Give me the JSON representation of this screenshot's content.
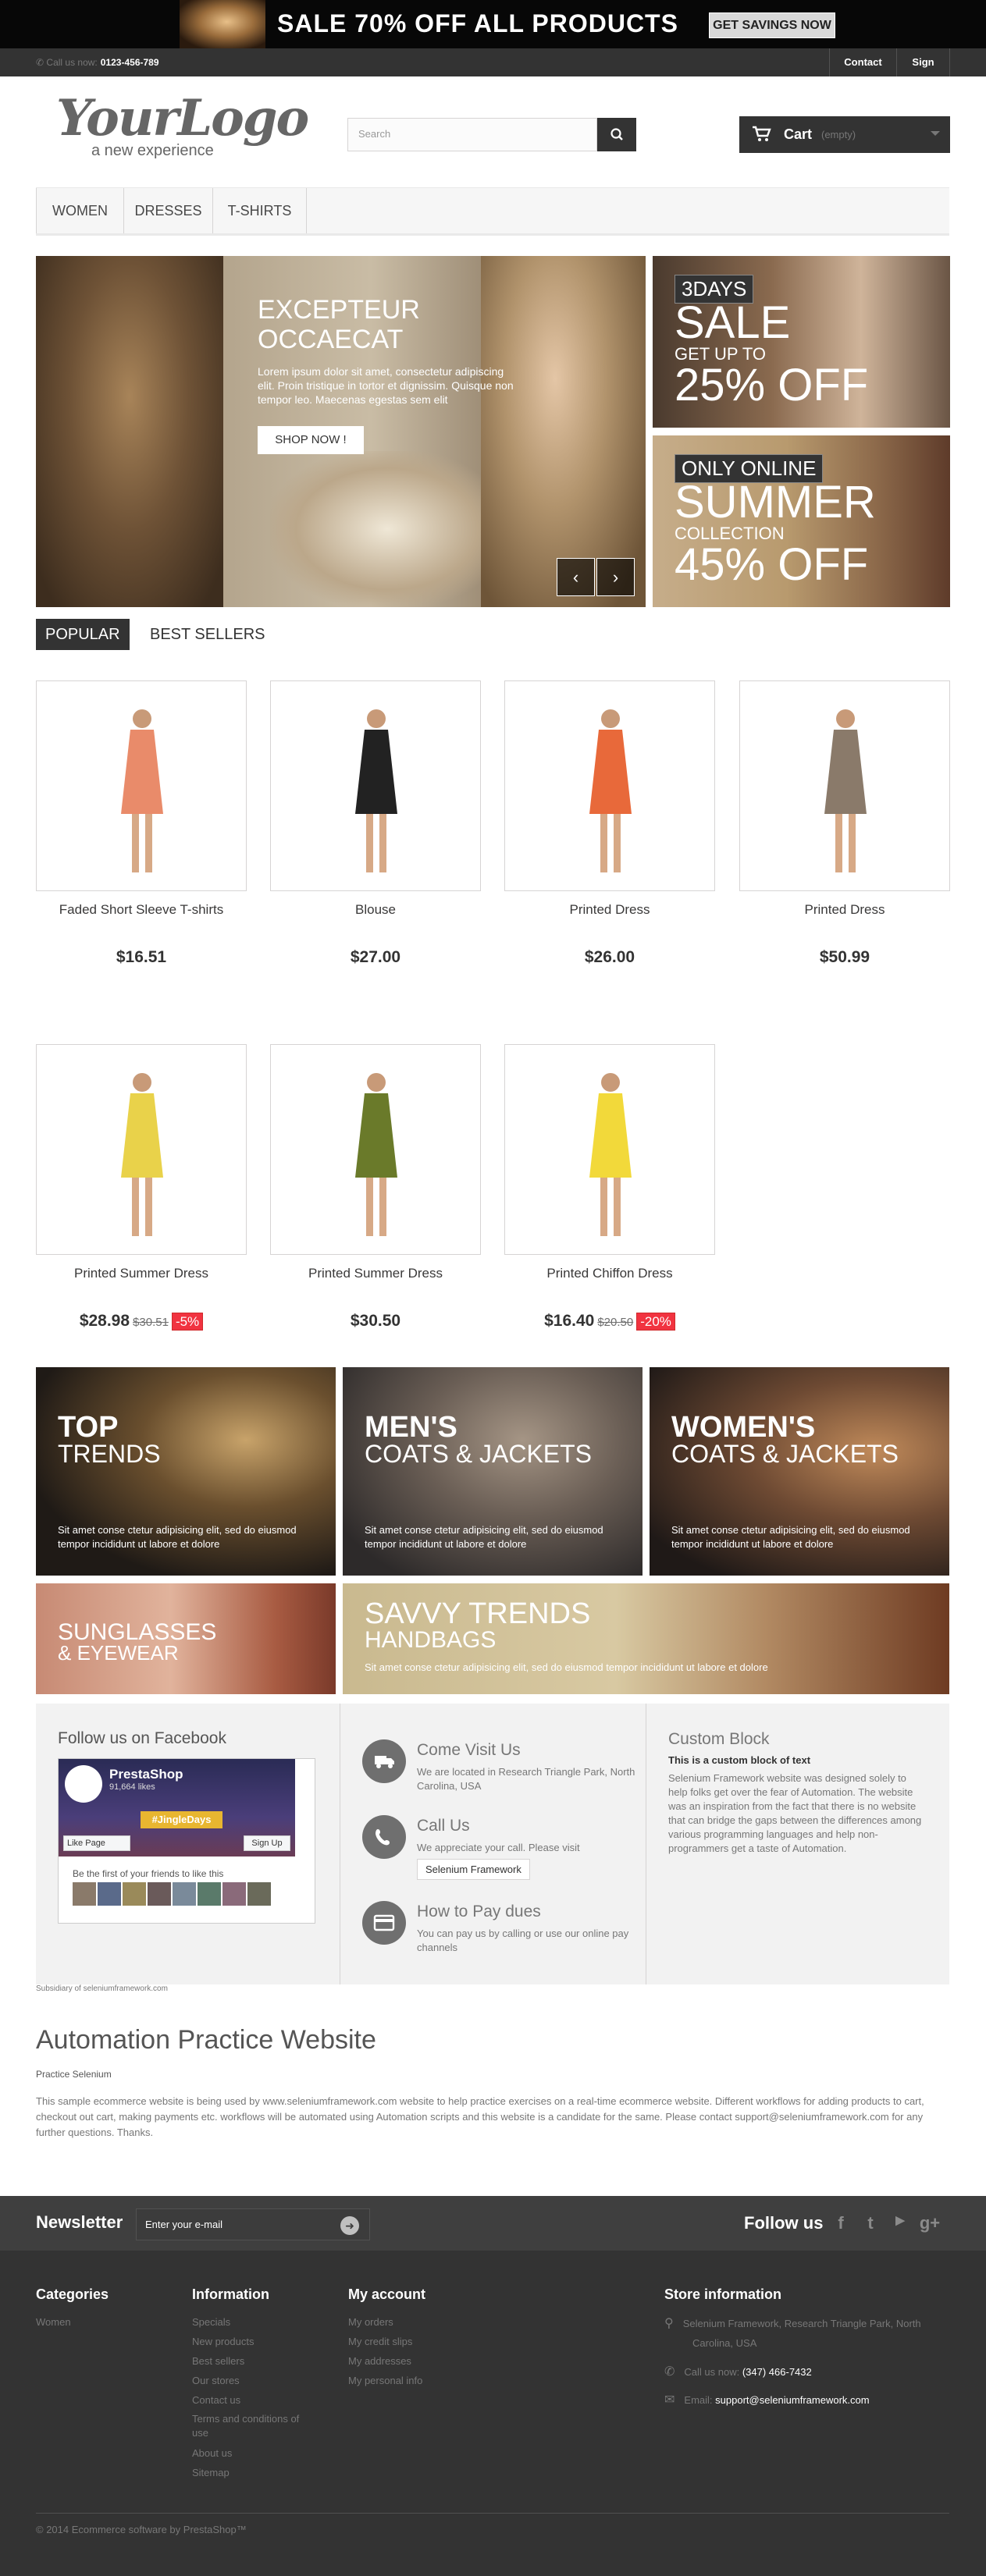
{
  "promo": {
    "text": "SALE 70% OFF ALL PRODUCTS",
    "button": "GET SAVINGS NOW"
  },
  "topbar": {
    "call_label": "Call us now:",
    "phone": "0123-456-789",
    "contact": "Contact us",
    "signin": "Sign in"
  },
  "header": {
    "logo_main": "YourLogo",
    "logo_sub": "a new experience",
    "search_placeholder": "Search",
    "cart_label": "Cart",
    "cart_state": "(empty)"
  },
  "menu": [
    "WOMEN",
    "DRESSES",
    "T-SHIRTS"
  ],
  "slider": {
    "heading_line1": "EXCEPTEUR",
    "heading_line2": "OCCAECAT",
    "text": "Lorem ipsum dolor sit amet, consectetur adipiscing elit. Proin tristique in tortor et dignissim. Quisque non tempor leo. Maecenas egestas sem elit",
    "button": "SHOP NOW !",
    "prev": "‹",
    "next": "›"
  },
  "side_banners": [
    {
      "tag": "3DAYS",
      "big": "SALE",
      "small": "GET UP TO",
      "value": "25% OFF"
    },
    {
      "tag": "ONLY ONLINE",
      "big": "SUMMER",
      "small": "COLLECTION",
      "value": "45% OFF"
    }
  ],
  "tabs": {
    "popular": "POPULAR",
    "best_sellers": "BEST SELLERS"
  },
  "products": [
    {
      "name": "Faded Short Sleeve T-shirts",
      "price": "$16.51",
      "old": "",
      "discount": ""
    },
    {
      "name": "Blouse",
      "price": "$27.00",
      "old": "",
      "discount": ""
    },
    {
      "name": "Printed Dress",
      "price": "$26.00",
      "old": "",
      "discount": ""
    },
    {
      "name": "Printed Dress",
      "price": "$50.99",
      "old": "",
      "discount": ""
    },
    {
      "name": "Printed Summer Dress",
      "price": "$28.98",
      "old": "$30.51",
      "discount": "-5%"
    },
    {
      "name": "Printed Summer Dress",
      "price": "$30.50",
      "old": "",
      "discount": ""
    },
    {
      "name": "Printed Chiffon Dress",
      "price": "$16.40",
      "old": "$20.50",
      "discount": "-20%"
    }
  ],
  "html_banners": [
    {
      "t1": "TOP",
      "t2": "TRENDS",
      "desc": "Sit amet conse ctetur adipisicing elit, sed do eiusmod tempor incididunt ut labore et dolore"
    },
    {
      "t1": "MEN'S",
      "t2": "COATS & JACKETS",
      "desc": "Sit amet conse ctetur adipisicing elit, sed do eiusmod tempor incididunt ut labore et dolore"
    },
    {
      "t1": "WOMEN'S",
      "t2": "COATS & JACKETS",
      "desc": "Sit amet conse ctetur adipisicing elit, sed do eiusmod tempor incididunt ut labore et dolore"
    },
    {
      "t1": "SUNGLASSES",
      "t2": "& EYEWEAR",
      "desc": ""
    },
    {
      "t1": "SAVVY TRENDS",
      "t2": "HANDBAGS",
      "desc": "Sit amet conse ctetur adipisicing elit, sed do eiusmod tempor incididunt ut labore et dolore"
    }
  ],
  "facebook": {
    "title": "Follow us on Facebook",
    "page": "PrestaShop",
    "likes": "91,664 likes",
    "hashtag": "#JingleDays",
    "like_page": "Like Page",
    "sign_up": "Sign Up",
    "first": "Be the first of your friends to like this"
  },
  "cms": [
    {
      "title": "Come Visit Us",
      "text": "We are located in Research Triangle Park, North Carolina, USA",
      "button": ""
    },
    {
      "title": "Call Us",
      "text": "We appreciate your call. Please visit",
      "button": "Selenium Framework"
    },
    {
      "title": "How to Pay dues",
      "text": "You can pay us by calling or use our online pay channels",
      "button": ""
    }
  ],
  "custom_block": {
    "title": "Custom Block",
    "subtitle": "This is a custom block of text",
    "text": "Selenium Framework website was designed solely to help folks get over the fear of Automation. The website was an inspiration from the fact that there is no website that can bridge the gaps between the differences among various programming languages and help non-programmers get a taste of Automation."
  },
  "subsidiary": "Subsidiary of seleniumframework.com",
  "about": {
    "title": "Automation Practice Website",
    "sub": "Practice Selenium",
    "text": "This sample ecommerce website is being used by www.seleniumframework.com website to help practice exercises on a real-time ecommerce website. Different workflows for adding products to cart, checkout out cart, making payments etc. workflows will be automated using Automation scripts and this website is a candidate for the same. Please contact support@seleniumframework.com for any further questions. Thanks."
  },
  "newsletter": {
    "title": "Newsletter",
    "placeholder": "Enter your e-mail",
    "follow": "Follow us"
  },
  "footer": {
    "categories": {
      "title": "Categories",
      "items": [
        "Women"
      ]
    },
    "information": {
      "title": "Information",
      "items": [
        "Specials",
        "New products",
        "Best sellers",
        "Our stores",
        "Contact us",
        "Terms and conditions of",
        "use",
        "About us",
        "Sitemap"
      ]
    },
    "account": {
      "title": "My account",
      "items": [
        "My orders",
        "My credit slips",
        "My addresses",
        "My personal info"
      ]
    },
    "store": {
      "title": "Store information",
      "address1": "Selenium Framework, Research Triangle Park, North",
      "address2": "Carolina, USA",
      "call_label": "Call us now:",
      "phone": "(347) 466-7432",
      "email_label": "Email:",
      "email": "support@seleniumframework.com"
    },
    "copyright": "© 2014 Ecommerce software by PrestaShop™"
  }
}
